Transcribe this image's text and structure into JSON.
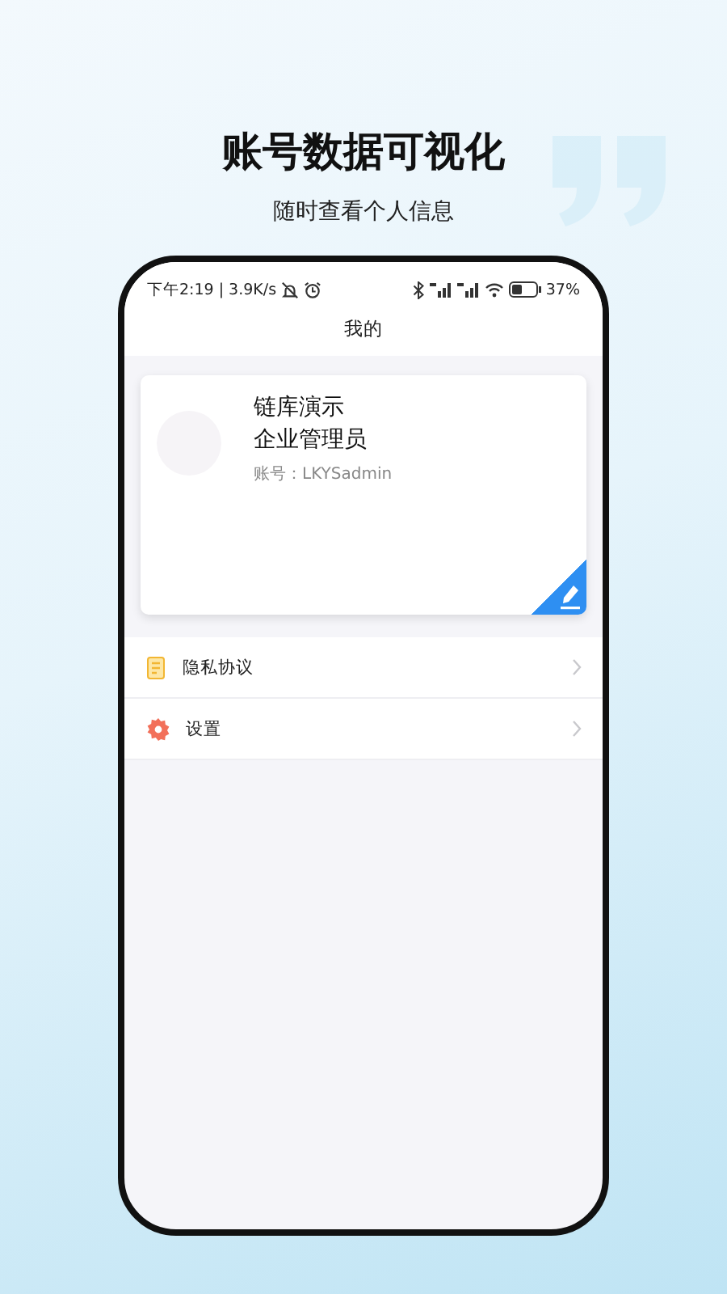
{
  "headline": "账号数据可视化",
  "subtitle": "随时查看个人信息",
  "status_bar": {
    "time": "下午2:19",
    "separator": "|",
    "speed": "3.9K/s",
    "battery": "37%"
  },
  "title": "我的",
  "profile": {
    "name": "链库演示",
    "role": "企业管理员",
    "account": "账号：LKYSadmin"
  },
  "menu": [
    {
      "kind": "document",
      "label": "隐私协议"
    },
    {
      "kind": "gear",
      "label": "设置"
    }
  ]
}
